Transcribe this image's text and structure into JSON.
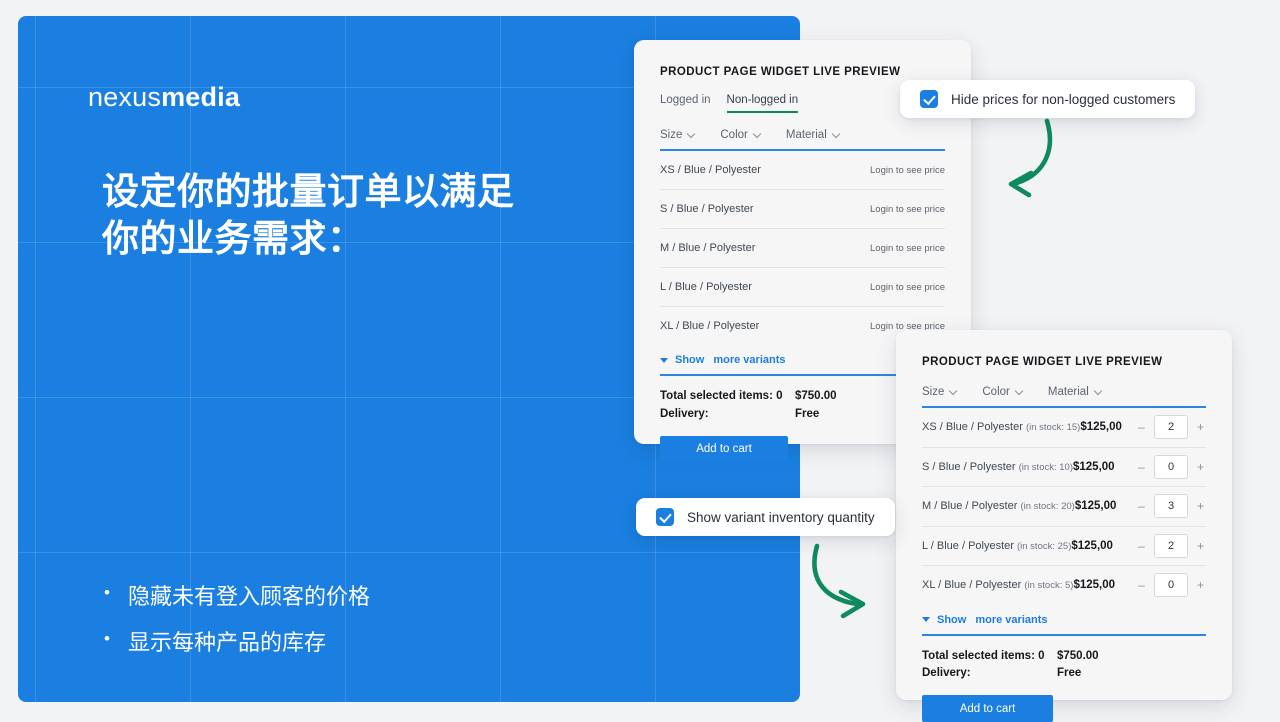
{
  "hero": {
    "logo_thin": "nexus",
    "logo_bold": "media",
    "title": "设定你的批量订单以满足你的业务需求：",
    "bullets": [
      "隐藏未有登入顾客的价格",
      "显示每种产品的库存"
    ],
    "accent_color": "#1a7fe0"
  },
  "callouts": [
    {
      "label": "Hide prices for non-logged customers",
      "checked": true
    },
    {
      "label": "Show variant inventory quantity",
      "checked": true
    }
  ],
  "card_back": {
    "widget_title": "PRODUCT PAGE WIDGET LIVE PREVIEW",
    "tabs": [
      {
        "label": "Logged in",
        "active": false
      },
      {
        "label": "Non-logged in",
        "active": true
      }
    ],
    "tab_active_color": "#0f8a5f",
    "filters": [
      "Size",
      "Color",
      "Material"
    ],
    "rows": [
      {
        "name": "XS / Blue / Polyester",
        "price_text": "Login to see price"
      },
      {
        "name": "S / Blue / Polyester",
        "price_text": "Login to see price"
      },
      {
        "name": "M / Blue / Polyester",
        "price_text": "Login to see price"
      },
      {
        "name": "L / Blue / Polyester",
        "price_text": "Login to see price"
      },
      {
        "name": "XL / Blue / Polyester",
        "price_text": "Login to see price"
      }
    ],
    "show_more_1": "Show",
    "show_more_2": "more variants",
    "totals": [
      {
        "label": "Total selected items: 0",
        "value": "$750.00"
      },
      {
        "label": "Delivery:",
        "value": "Free"
      }
    ],
    "add_to_cart": "Add to cart"
  },
  "card_front": {
    "widget_title": "PRODUCT PAGE WIDGET LIVE PREVIEW",
    "filters": [
      "Size",
      "Color",
      "Material"
    ],
    "rows": [
      {
        "name": "XS / Blue / Polyester",
        "stock": "(in stock: 15)",
        "price": "$125,00",
        "qty": "2"
      },
      {
        "name": "S / Blue / Polyester",
        "stock": "(in stock: 10)",
        "price": "$125,00",
        "qty": "0"
      },
      {
        "name": "M / Blue / Polyester",
        "stock": "(in stock: 20)",
        "price": "$125,00",
        "qty": "3"
      },
      {
        "name": "L / Blue / Polyester",
        "stock": "(in stock: 25)",
        "price": "$125,00",
        "qty": "2"
      },
      {
        "name": "XL / Blue / Polyester",
        "stock": "(in stock: 5)",
        "price": "$125,00",
        "qty": "0"
      }
    ],
    "minus": "–",
    "plus": "+",
    "show_more_1": "Show",
    "show_more_2": "more variants",
    "totals": [
      {
        "label": "Total selected items: 0",
        "value": "$750.00"
      },
      {
        "label": "Delivery:",
        "value": "Free"
      }
    ],
    "add_to_cart": "Add to cart"
  },
  "arrows": {
    "color": "#0f8a5f"
  }
}
